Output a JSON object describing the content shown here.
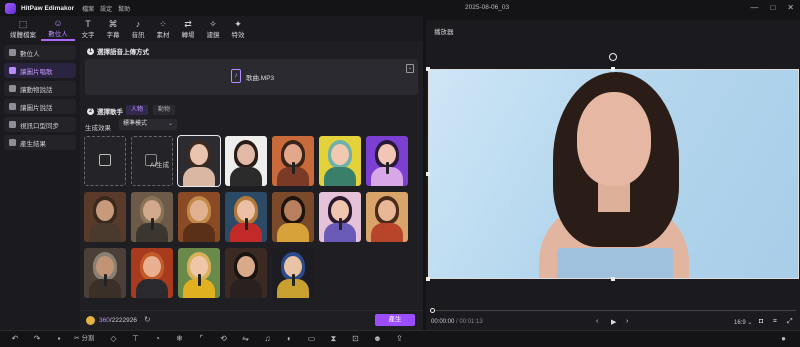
{
  "app": {
    "name": "HitPaw Edimakor",
    "menu": [
      "檔案",
      "設定",
      "幫助"
    ],
    "doc_title": "2025-08-06_03",
    "window_controls": [
      "—",
      "□",
      "✕"
    ]
  },
  "toolbar": {
    "items": [
      {
        "label": "媒體檔案",
        "icon": "media-icon"
      },
      {
        "label": "數位人",
        "icon": "avatar-icon",
        "active": true
      },
      {
        "label": "文字",
        "icon": "text-icon"
      },
      {
        "label": "字幕",
        "icon": "subtitle-icon"
      },
      {
        "label": "音訊",
        "icon": "music-icon"
      },
      {
        "label": "素材",
        "icon": "elements-icon"
      },
      {
        "label": "轉場",
        "icon": "transition-icon"
      },
      {
        "label": "濾鏡",
        "icon": "filter-icon"
      },
      {
        "label": "特效",
        "icon": "effects-icon"
      }
    ]
  },
  "sidebar": {
    "items": [
      {
        "label": "數位人",
        "active": false
      },
      {
        "label": "讓圖片唱歌",
        "active": true
      },
      {
        "label": "讓動物說話",
        "active": false
      },
      {
        "label": "讓圖片說話",
        "active": false
      },
      {
        "label": "視訊口型同步",
        "active": false
      },
      {
        "label": "產生結果",
        "active": false
      }
    ]
  },
  "panel": {
    "step1": {
      "number": "1",
      "title": "選擇語音上傳方式"
    },
    "upload": {
      "file_name": "歌曲.MP3"
    },
    "step2": {
      "number": "2",
      "title": "選擇歌手"
    },
    "tabs": [
      {
        "label": "人物",
        "active": true
      },
      {
        "label": "動物",
        "active": false
      }
    ],
    "effect": {
      "label": "生成效果",
      "selected": "標準模式"
    },
    "ai_generate_label": "AI生成",
    "singers": [
      {
        "bg": "#2b2b30",
        "hair": "#3a2a22",
        "skin": "#e9c3ae",
        "torso": "#d9b7a3",
        "selected": true
      },
      {
        "bg": "#eeeeee",
        "hair": "#2a1d17",
        "skin": "#e1b9a6",
        "torso": "#2b2b2b",
        "selected": false
      },
      {
        "bg": "#c86a3a",
        "hair": "#3b2418",
        "skin": "#e3a88b",
        "torso": "#7a3a25",
        "selected": false
      },
      {
        "bg": "#e3d23a",
        "hair": "#6fb0a8",
        "skin": "#f0c9b0",
        "torso": "#3a7f6a",
        "selected": false
      },
      {
        "bg": "#7b3fd1",
        "hair": "#2a1a3a",
        "skin": "#f2c6b5",
        "torso": "#d8a7e8",
        "selected": false
      },
      {
        "bg": "#5a3a2a",
        "hair": "#3a2a1e",
        "skin": "#c89a7c",
        "torso": "#4a3a2e",
        "selected": false
      },
      {
        "bg": "#6e5a48",
        "hair": "#8a7458",
        "skin": "#d2a98c",
        "torso": "#3c3630",
        "selected": false
      },
      {
        "bg": "#8a4a24",
        "hair": "#c28a4a",
        "skin": "#e2b290",
        "torso": "#5a3018",
        "selected": false
      },
      {
        "bg": "#2c4a66",
        "hair": "#b07a3a",
        "skin": "#ecc0a4",
        "torso": "#c22a2a",
        "selected": false
      },
      {
        "bg": "#7a4a2a",
        "hair": "#1e120c",
        "skin": "#b8805e",
        "torso": "#d8a23a",
        "selected": false
      },
      {
        "bg": "#e6c2d8",
        "hair": "#2a1a2e",
        "skin": "#f0c6b0",
        "torso": "#6a5ab8",
        "selected": false
      },
      {
        "bg": "#d8a46a",
        "hair": "#4a2a1a",
        "skin": "#e8b896",
        "torso": "#b8452a",
        "selected": false
      },
      {
        "bg": "#4a4038",
        "hair": "#8a8072",
        "skin": "#c29476",
        "torso": "#3a3028",
        "selected": false
      },
      {
        "bg": "#a83a1e",
        "hair": "#c25a2a",
        "skin": "#e8b090",
        "torso": "#2a2a2e",
        "selected": false
      },
      {
        "bg": "#6a8a4a",
        "hair": "#d8b05a",
        "skin": "#f0c6a8",
        "torso": "#e0b020",
        "selected": false
      },
      {
        "bg": "#3a2a22",
        "hair": "#1a1410",
        "skin": "#d8aa8a",
        "torso": "#2a2020",
        "selected": false
      },
      {
        "bg": "#1c1c22",
        "hair": "#2a4a8a",
        "skin": "#e8c4a4",
        "torso": "#c8a030",
        "selected": false
      }
    ],
    "credits": {
      "used": "360",
      "total": "/2222926"
    },
    "generate_label": "產生"
  },
  "player": {
    "title": "播放器",
    "time_current": "00:00:00",
    "time_total": "/ 00:01:13",
    "ratio": "16:9",
    "ratio_chevron": "⌄"
  },
  "bottom_toolbar": {
    "split_label": "分割"
  }
}
